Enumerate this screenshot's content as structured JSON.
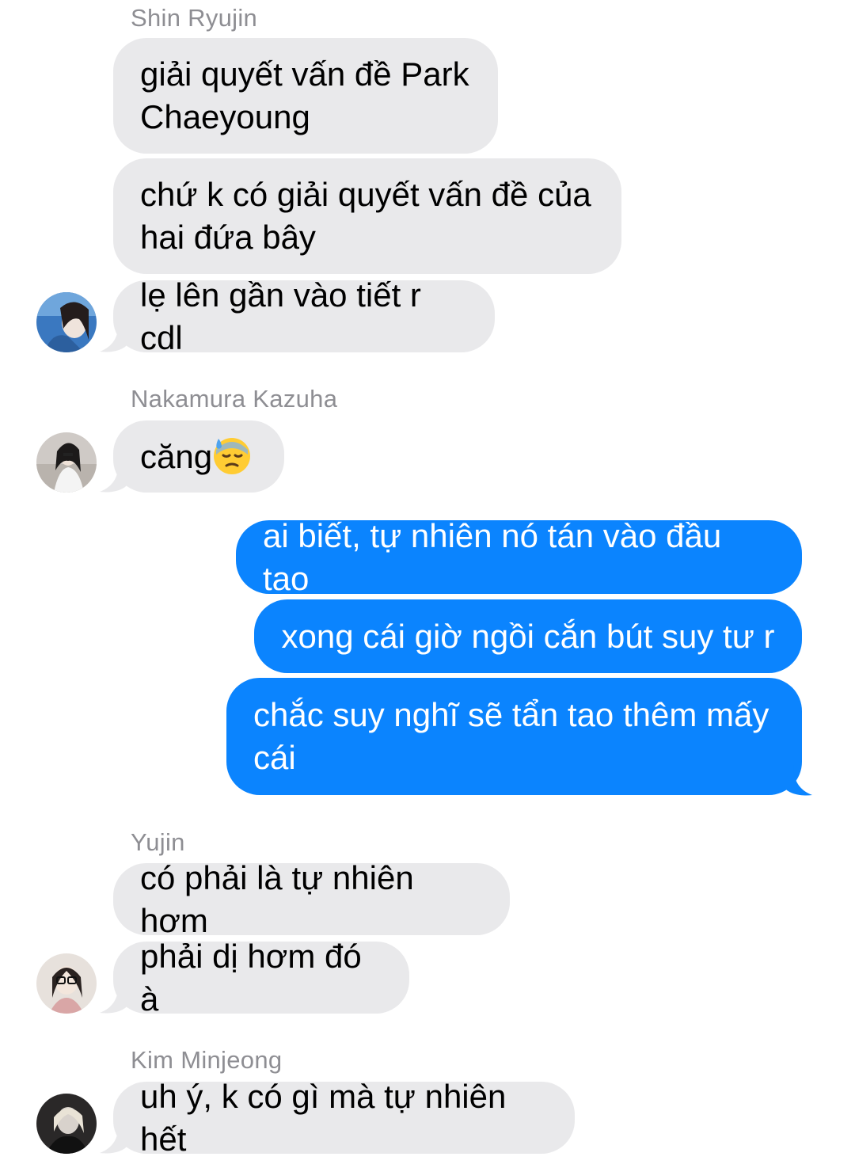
{
  "messages": [
    {
      "sender": "Shin Ryujin",
      "bubbles": [
        "giải quyết vấn đề Park\nChaeyoung",
        "chứ k có giải quyết vấn đề của\nhai đứa bây",
        "lẹ lên gần vào tiết r cdl"
      ]
    },
    {
      "sender": "Nakamura Kazuha",
      "bubbles": [
        "căng"
      ],
      "emoji": "downcast-face-with-sweat"
    },
    {
      "sender": "",
      "outgoing": true,
      "bubbles": [
        "ai biết, tự nhiên nó tán vào đầu tao",
        "xong cái giờ ngồi cắn bút suy tư r",
        "chắc suy nghĩ sẽ tẩn tao thêm mấy\ncái"
      ]
    },
    {
      "sender": "Yujin",
      "bubbles": [
        "có phải là tự nhiên hơm",
        "phải dị hơm đó à"
      ]
    },
    {
      "sender": "Kim Minjeong",
      "bubbles": [
        "uh ý, k có gì mà tự nhiên hết"
      ]
    }
  ],
  "colors": {
    "incoming_bubble": "#e9e9eb",
    "outgoing_bubble": "#0b84fe",
    "sender_name": "#8e8e93"
  }
}
